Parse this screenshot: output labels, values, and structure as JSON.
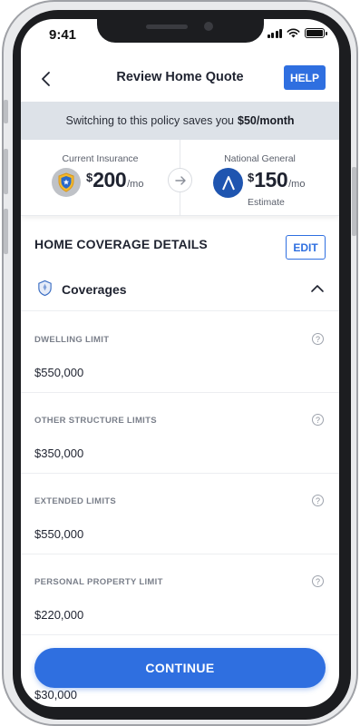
{
  "status_bar": {
    "time": "9:41"
  },
  "header": {
    "title": "Review Home Quote",
    "help_label": "HELP"
  },
  "savings": {
    "text": "Switching to this policy saves you",
    "amount": "$50/month"
  },
  "current_policy": {
    "label": "Current Insurance",
    "currency": "$",
    "amount": "200",
    "period": "/mo"
  },
  "new_policy": {
    "label": "National General",
    "currency": "$",
    "amount": "150",
    "period": "/mo",
    "note": "Estimate"
  },
  "details": {
    "title": "HOME COVERAGE DETAILS",
    "edit_label": "EDIT",
    "section_label": "Coverages",
    "fields": [
      {
        "label": "DWELLING LIMIT",
        "value": "$550,000"
      },
      {
        "label": "OTHER STRUCTURE LIMITS",
        "value": "$350,000"
      },
      {
        "label": "EXTENDED LIMITS",
        "value": "$550,000"
      },
      {
        "label": "PERSONAL PROPERTY LIMIT",
        "value": "$220,000"
      }
    ],
    "partial_value": "$30,000"
  },
  "footer": {
    "continue_label": "CONTINUE"
  },
  "colors": {
    "accent": "#2f6fe0",
    "banner_bg": "#dde2e8",
    "brand_badge": "#1f55b0"
  },
  "icons": [
    "back-icon",
    "help-icon",
    "shield-icon",
    "arrow-right-icon",
    "national-general-logo-icon",
    "coverages-icon",
    "chevron-up-icon",
    "question-icon"
  ]
}
